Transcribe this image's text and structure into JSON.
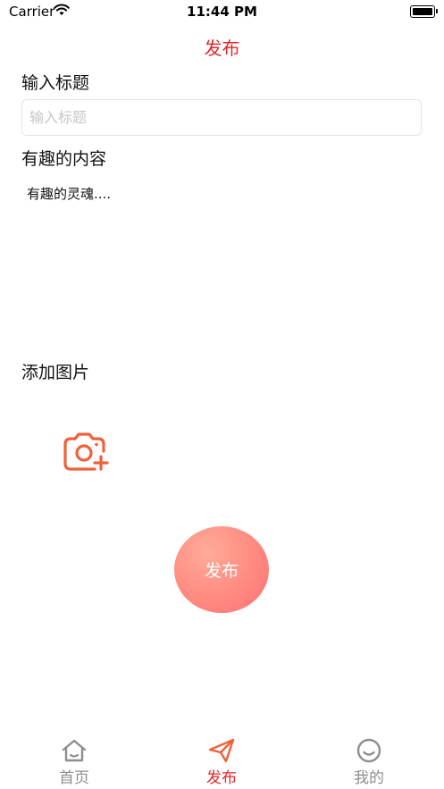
{
  "status_bar": {
    "carrier": "Carrier",
    "time": "11:44 PM"
  },
  "nav": {
    "title": "发布"
  },
  "form": {
    "title_label": "输入标题",
    "title_placeholder": "输入标题",
    "title_value": "",
    "content_label": "有趣的内容",
    "content_value": "有趣的灵魂....",
    "image_label": "添加图片",
    "add_photo_icon": "camera-plus-icon",
    "publish_label": "发布"
  },
  "tab_bar": {
    "items": [
      {
        "label": "首页",
        "icon": "home-icon",
        "active": false
      },
      {
        "label": "发布",
        "icon": "paper-plane-icon",
        "active": true
      },
      {
        "label": "我的",
        "icon": "smiley-icon",
        "active": false
      }
    ]
  },
  "colors": {
    "accent": "#e0282a",
    "icon_orange": "#f0613a",
    "button_gradient_start": "#ffab98",
    "button_gradient_end": "#ff7176",
    "tab_inactive": "#8e8e8e"
  }
}
